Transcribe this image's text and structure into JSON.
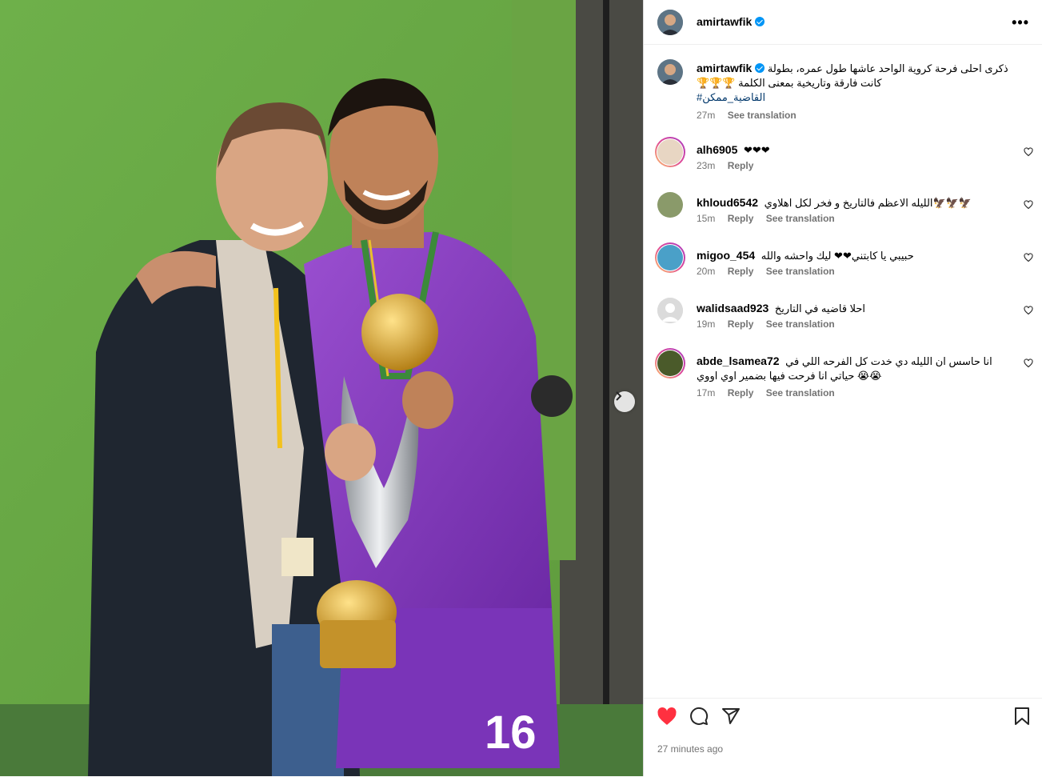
{
  "post": {
    "author": "amirtawfik",
    "verified": true,
    "caption_text": "ذكرى احلى فرحة كروية الواحد عاشها طول عمره، بطولة كانت فارقة وتاريخية بمعنى الكلمة 🏆🏆🏆",
    "hashtag": "#القاضية_ممكن",
    "caption_time": "27m",
    "see_translation": "See translation",
    "time_ago": "27 minutes ago"
  },
  "comments": [
    {
      "user": "alh6905",
      "text": "❤❤❤",
      "time": "23m",
      "reply": "Reply",
      "translation": "",
      "story_ring": true,
      "avatar_color": "#e8d6c3"
    },
    {
      "user": "khloud6542",
      "text": "الليله الاعظم فالتاريخ و فخر لكل اهلاوي🦅🦅🦅",
      "time": "15m",
      "reply": "Reply",
      "translation": "See translation",
      "story_ring": false,
      "avatar_color": "#8a9a6a"
    },
    {
      "user": "migoo_454",
      "text": "حبيبي يا كابتني❤❤ ليك واحشه والله",
      "time": "20m",
      "reply": "Reply",
      "translation": "See translation",
      "story_ring": true,
      "avatar_color": "#4aa0c8"
    },
    {
      "user": "walidsaad923",
      "text": "احلا قاضيه في التاريخ",
      "time": "19m",
      "reply": "Reply",
      "translation": "See translation",
      "story_ring": false,
      "avatar_color": "#dbdbdb"
    },
    {
      "user": "abde_lsamea72",
      "text": "انا حاسس ان الليله دي خدت كل الفرحه اللي في حياتي انا فرحت فيها بضمير اوي اووي 😭😭",
      "time": "17m",
      "reply": "Reply",
      "translation": "See translation",
      "story_ring": true,
      "avatar_color": "#4a5a2a"
    }
  ],
  "icons": {
    "more": "more-horizontal-icon",
    "like": "heart-filled-icon",
    "comment": "comment-icon",
    "share": "share-icon",
    "save": "bookmark-icon",
    "next": "chevron-right-icon"
  },
  "colors": {
    "accent": "#0095f6",
    "like_red": "#ff3040",
    "muted": "#737373",
    "hashtag": "#00376b"
  }
}
